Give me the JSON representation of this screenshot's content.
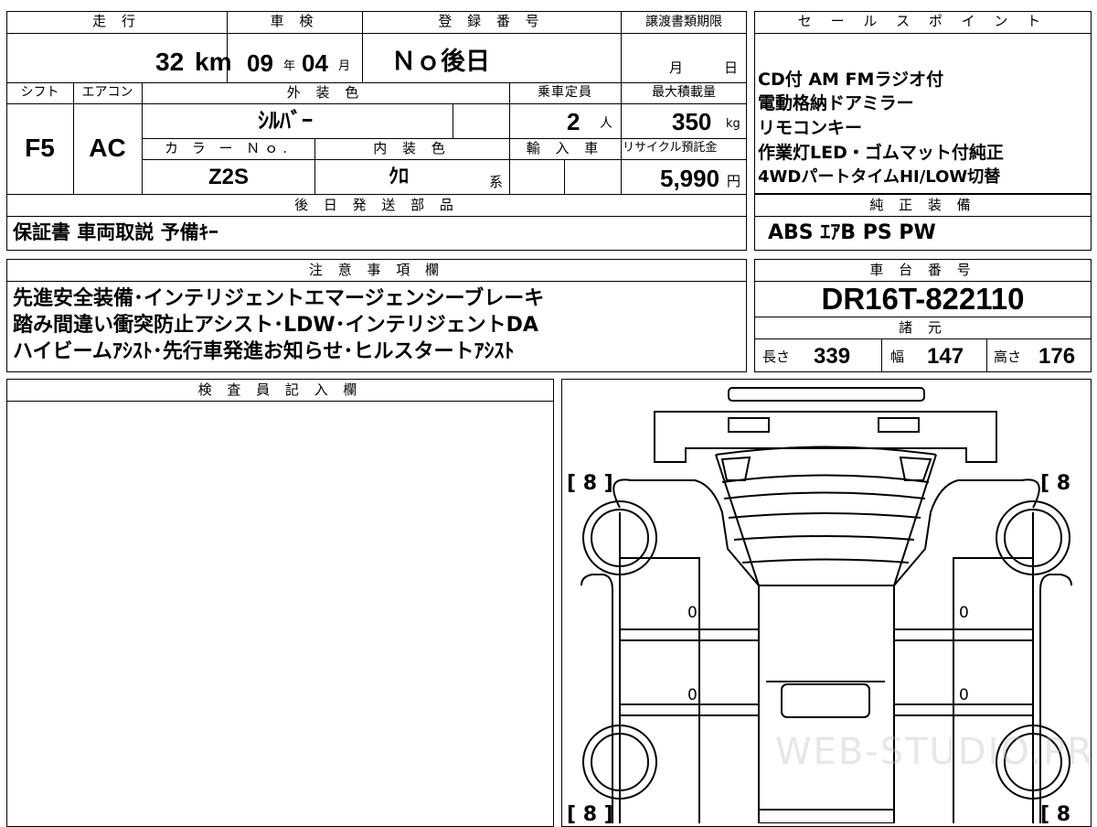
{
  "main_table": {
    "mileage_label": "走 行",
    "mileage_value": "32",
    "mileage_unit": "km",
    "inspection_label": "車 検",
    "inspection_year": "09",
    "inspection_year_unit": "年",
    "inspection_month": "04",
    "inspection_month_unit": "月",
    "registration_label": "登 録 番 号",
    "registration_value": "Ｎｏ後日",
    "transfer_deadline_label": "譲渡書類期限",
    "transfer_month_unit": "月",
    "transfer_day_unit": "日",
    "shift_label": "シフト",
    "shift_value": "F5",
    "ac_label": "エアコン",
    "ac_value": "AC",
    "exterior_color_label": "外 装 色",
    "exterior_color_value": "ｼﾙﾊﾞｰ",
    "capacity_label": "乗車定員",
    "capacity_value": "2",
    "capacity_unit": "人",
    "max_load_label": "最大積載量",
    "max_load_value": "350",
    "max_load_unit": "kg",
    "color_no_label": "カ ラ ー Ｎｏ.",
    "color_no_value": "Z2S",
    "interior_color_label": "内 装 色",
    "interior_color_value": "ｸﾛ",
    "interior_color_suffix": "系",
    "import_label": "輸 入 車",
    "recycle_label": "リサイクル預託金",
    "recycle_value": "5,990",
    "recycle_unit": "円",
    "later_parts_label": "後 日 発 送 部 品",
    "later_parts_value": "保証書  車両取説  予備ｷｰ"
  },
  "sales_points": {
    "label": "セ ー ル ス ポ イ ン ト",
    "lines": [
      "CD付  AM  FMラジオ付",
      "電動格納ドアミラー",
      "リモコンキー",
      "作業灯LED・ゴムマット付純正",
      "4WDパートタイムHI/LOW切替"
    ]
  },
  "genuine_equipment": {
    "label": "純 正 装 備",
    "value": "ABS  ｴｱB  PS  PW"
  },
  "notes": {
    "label": "注 意 事 項 欄",
    "lines": [
      "先進安全装備･インテリジェントエマージェンシーブレーキ",
      "踏み間違い衝突防止アシスト･LDW･インテリジェントDA",
      "ハイビームｱｼｽﾄ･先行車発進お知らせ･ヒルスタートｱｼｽﾄ"
    ]
  },
  "chassis": {
    "label": "車 台 番 号",
    "value": "DR16T-822110"
  },
  "specs": {
    "label": "諸 元",
    "length_label": "長さ",
    "length_value": "339",
    "width_label": "幅",
    "width_value": "147",
    "height_label": "高さ",
    "height_value": "176"
  },
  "inspector": {
    "label": "検 査 員 記 入 欄"
  },
  "diagram": {
    "tire_top_left": "[ 8 ]",
    "tire_top_right": "[ 8",
    "tire_bottom_left": "[ 8 ]",
    "tire_bottom_right": "[ 8",
    "mark_1": "0",
    "mark_2": "0",
    "mark_3": "0",
    "mark_4": "0",
    "watermark": "WEB-STUDIO.PRO"
  }
}
